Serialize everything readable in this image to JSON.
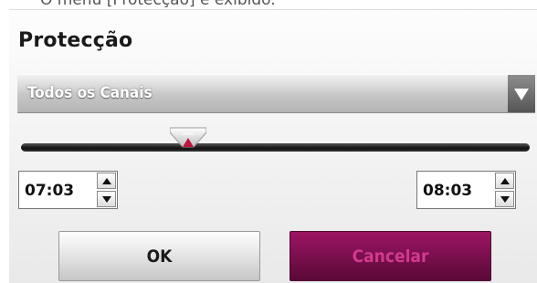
{
  "caption": "O menu [Protecção] é exibido.",
  "dialog": {
    "title": "Protecção",
    "dropdown": {
      "selected": "Todos os Canais",
      "arrow_icon": "triangle-down-icon"
    },
    "slider": {
      "thumb_icon": "slider-thumb-icon",
      "accent": "#c0143c"
    },
    "start_time": "07:03",
    "end_time": "08:03",
    "ok_label": "OK",
    "cancel_label": "Cancelar"
  },
  "colors": {
    "cancel_bg": "#7a0f4f",
    "cancel_text": "#d23a8c",
    "ok_bg": "#e8e8e8"
  }
}
